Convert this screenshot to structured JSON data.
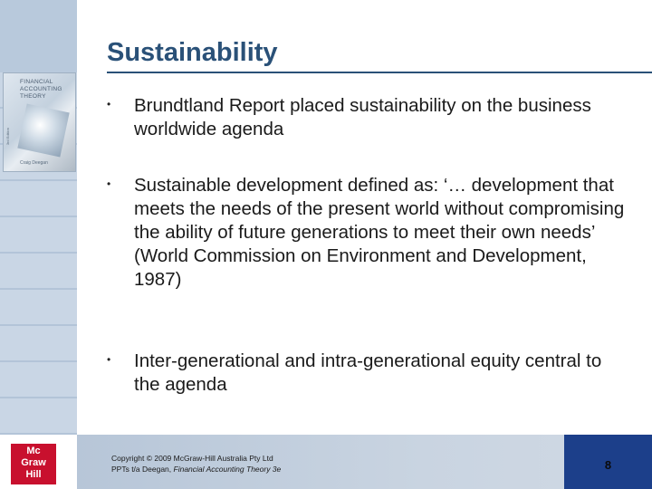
{
  "slide": {
    "title": "Sustainability",
    "bullets": [
      {
        "symbol": "•",
        "text": "Brundtland Report placed sustainability on the business worldwide agenda"
      },
      {
        "symbol": "•",
        "text": "Sustainable development defined as: ‘… development that meets the needs of the present world without compromising the ability of future generations to meet their own needs’ (World Commission on Environment and Development, 1987)"
      },
      {
        "symbol": "•",
        "text": "Inter-generational and intra-generational equity central to the agenda"
      }
    ]
  },
  "book": {
    "title_line1": "FINANCIAL",
    "title_line2": "ACCOUNTING",
    "title_line3": "THEORY",
    "author": "Craig Deegan",
    "edition": "3rd Edition"
  },
  "logo": {
    "line1": "Mc",
    "line2": "Graw",
    "line3": "Hill"
  },
  "footer": {
    "copyright": "Copyright © 2009 McGraw-Hill Australia Pty Ltd",
    "ppt_prefix": "PPTs t/a Deegan, ",
    "ppt_italic": "Financial Accounting Theory 3e",
    "page_number": "8"
  },
  "colors": {
    "title": "#2a5178",
    "page_box": "#1c3f8a",
    "logo": "#c8102e"
  }
}
